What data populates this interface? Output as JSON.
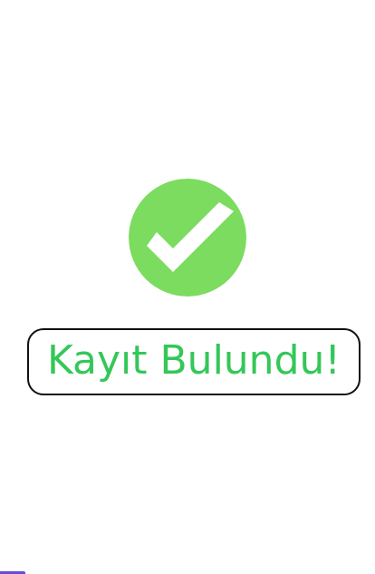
{
  "status": {
    "message": "Kayıt Bulundu!"
  },
  "icons": {
    "success": "checkmark-circle-icon"
  },
  "colors": {
    "background": "#ffffff",
    "success_circle": "#7bdc5f",
    "check_mark": "#ffffff",
    "text": "#34c759",
    "border": "#111111",
    "accent": "#6b49d8"
  }
}
